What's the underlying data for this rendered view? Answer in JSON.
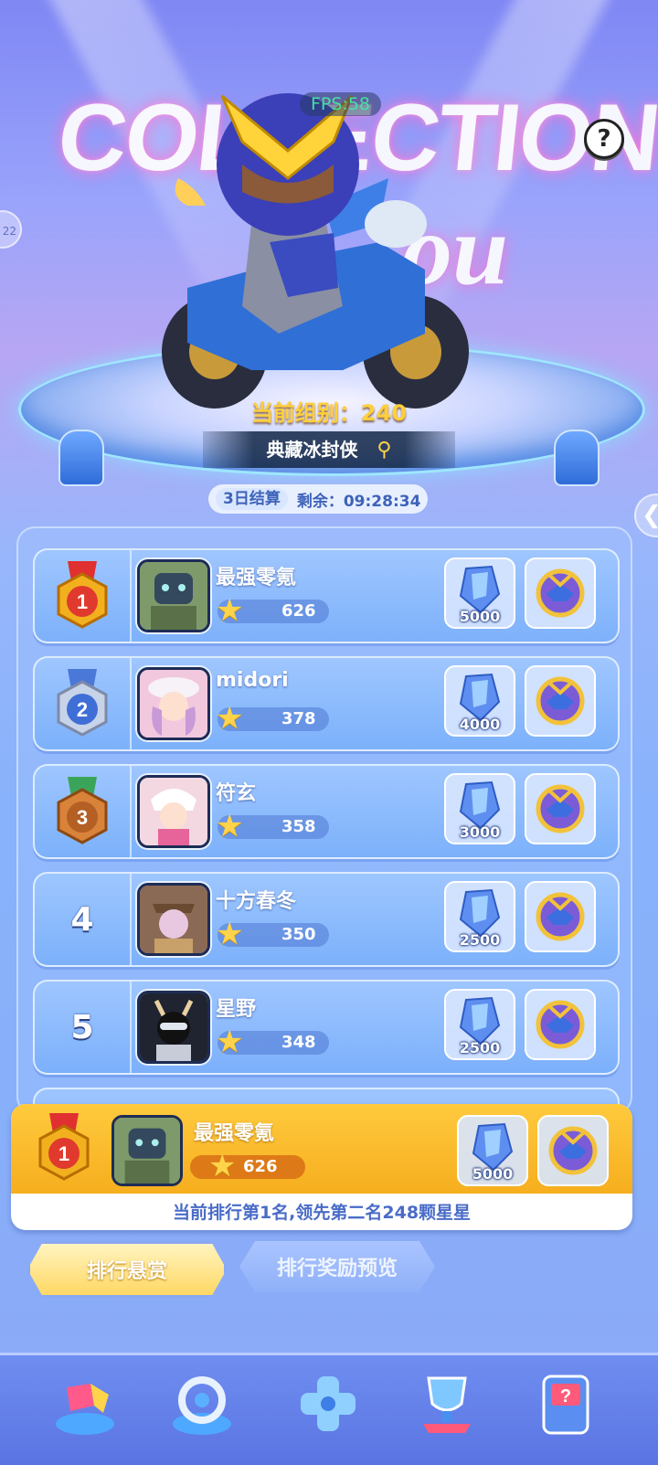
{
  "header": {
    "title_text": "COLLECTION",
    "title_sub": "ou",
    "fps": "FPS:58",
    "help_symbol": "?",
    "side_left_label": "22",
    "side_right_symbol": "❮"
  },
  "showcase": {
    "group_label": "当前组别：240",
    "item_name": "典藏冰封侠",
    "search_symbol": "⚲"
  },
  "timer": {
    "settle_label": "3日结算",
    "remaining_label": "剩余：09:28:34"
  },
  "leaderboard": {
    "rows": [
      {
        "rank": "1",
        "name": "最强零氪",
        "score": "626",
        "gems": "5000",
        "medal_color": "#f2b01e"
      },
      {
        "rank": "2",
        "name": "midori",
        "score": "378",
        "gems": "4000",
        "medal_color": "#b9c7de"
      },
      {
        "rank": "3",
        "name": "符玄",
        "score": "358",
        "gems": "3000",
        "medal_color": "#d9823a"
      },
      {
        "rank": "4",
        "name": "十方春冬",
        "score": "350",
        "gems": "2500"
      },
      {
        "rank": "5",
        "name": "星野",
        "score": "348",
        "gems": "2500"
      }
    ]
  },
  "my_rank": {
    "rank": "1",
    "name": "最强零氪",
    "score": "626",
    "gems": "5000",
    "status": "当前排行第1名,领先第二名248颗星星"
  },
  "tabs": {
    "active": "排行悬赏",
    "preview": "排行奖励预览"
  },
  "icons": {
    "star": "star-icon",
    "gem": "gem-icon",
    "badge": "hero-badge-icon",
    "medal": "medal-icon"
  },
  "colors": {
    "accent_gold": "#ffca3e",
    "score_star": "#ffd34a",
    "status_text": "#4a6cc8"
  },
  "nav": [
    "puzzle-nav-icon",
    "target-nav-icon",
    "gamepad-nav-icon",
    "trophy-nav-icon",
    "mystery-machine-nav-icon"
  ]
}
